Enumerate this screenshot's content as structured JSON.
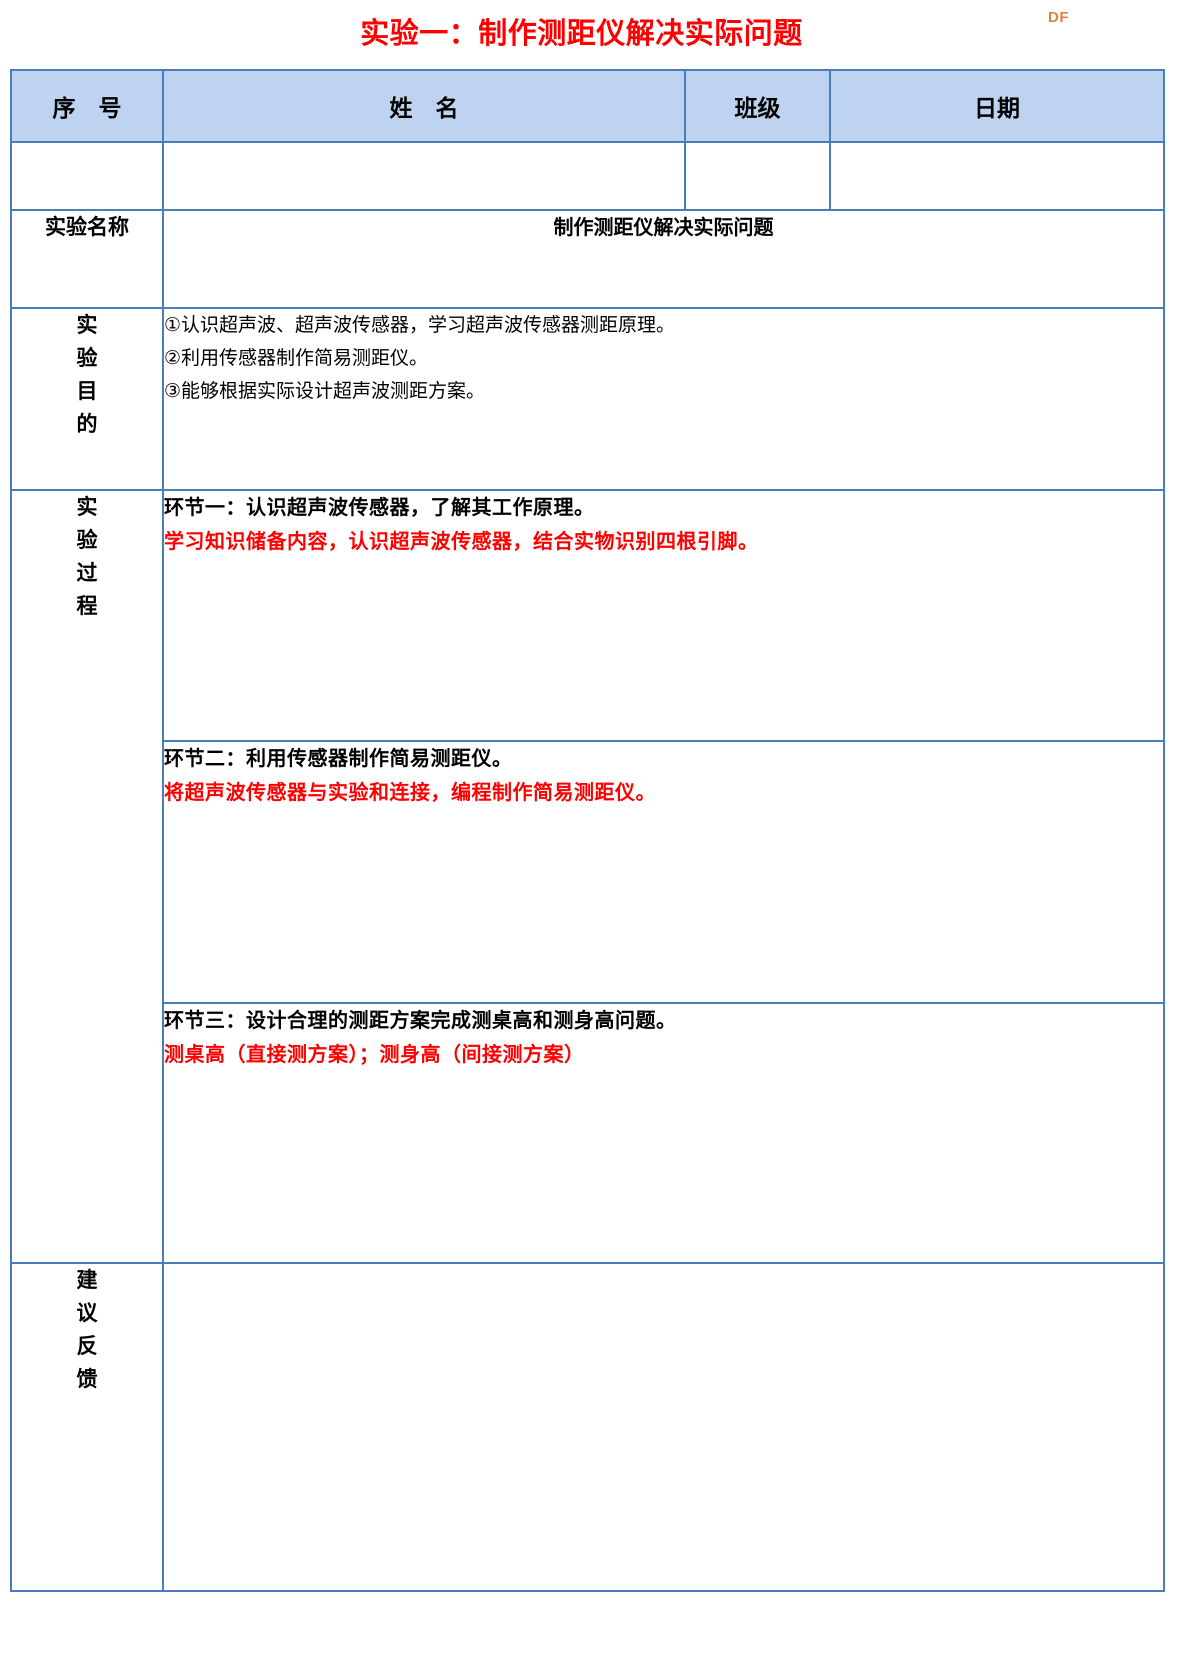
{
  "brand": {
    "logo_text": "DF"
  },
  "title": "实验一：制作测距仪解决实际问题",
  "table": {
    "headers": {
      "no": "序　号",
      "name": "姓　名",
      "class": "班级",
      "date": "日期"
    },
    "header_values": {
      "no": "",
      "name": "",
      "class": "",
      "date": ""
    },
    "experiment_name": {
      "label": "实验名称",
      "value": "制作测距仪解决实际问题"
    },
    "objective": {
      "label": "实验目的",
      "items": [
        "①认识超声波、超声波传感器，学习超声波传感器测距原理。",
        "②利用传感器制作简易测距仪。",
        "③能够根据实际设计超声波测距方案。"
      ]
    },
    "process": {
      "label": "实验过程",
      "steps": [
        {
          "heading": "环节一：认识超声波传感器，了解其工作原理。",
          "note": "学习知识储备内容，认识超声波传感器，结合实物识别四根引脚。"
        },
        {
          "heading": "环节二：利用传感器制作简易测距仪。",
          "note": "将超声波传感器与实验和连接，编程制作简易测距仪。"
        },
        {
          "heading": "环节三：设计合理的测距方案完成测桌高和测身高问题。",
          "note": "测桌高（直接测方案）；测身高（间接测方案）"
        }
      ]
    },
    "feedback": {
      "label": "建议反馈",
      "value": ""
    }
  },
  "colors": {
    "title_red": "#ff0000",
    "note_red": "#ff0000",
    "border_blue": "#4a7ebb",
    "header_fill": "#bdd3ef",
    "brand_orange": "#e2813f"
  }
}
